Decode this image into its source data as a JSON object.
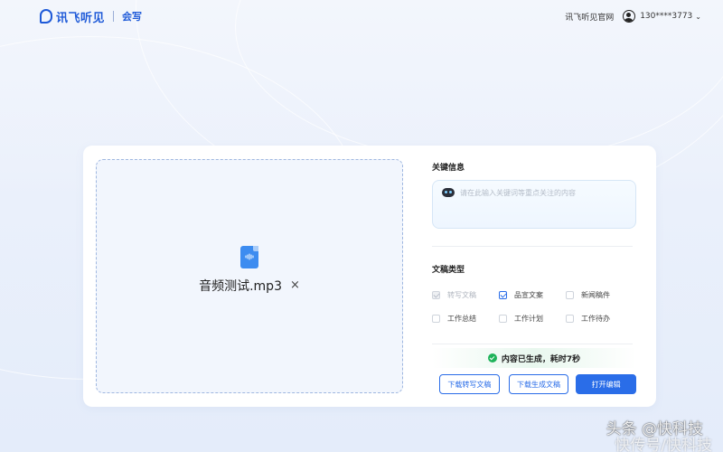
{
  "header": {
    "logo_text": "讯飞听见",
    "logo_sub": "会写",
    "official_site": "讯飞听见官网",
    "user_phone": "130****3773"
  },
  "upload": {
    "file_name": "音频测试.mp3",
    "close_glyph": "×",
    "file_icon": "audio-file-icon"
  },
  "keywords": {
    "title": "关键信息",
    "placeholder": "请在此输入关键词等重点关注的内容",
    "icon": "robot-icon"
  },
  "doc_types": {
    "title": "文稿类型",
    "options": [
      {
        "label": "转写文稿",
        "state": "checked-disabled"
      },
      {
        "label": "品宣文案",
        "state": "checked"
      },
      {
        "label": "新闻稿件",
        "state": "unchecked"
      },
      {
        "label": "工作总结",
        "state": "unchecked"
      },
      {
        "label": "工作计划",
        "state": "unchecked"
      },
      {
        "label": "工作待办",
        "state": "unchecked"
      }
    ]
  },
  "status": {
    "text": "内容已生成，耗时7秒",
    "icon": "check-circle-icon",
    "color": "#1fb35a"
  },
  "actions": {
    "download_transcript": "下载转写文稿",
    "download_generated": "下载生成文稿",
    "open_editor": "打开编辑"
  },
  "colors": {
    "accent": "#2a6de8",
    "brand": "#1e5ad8"
  },
  "watermark": {
    "line1": "头条 @快科技",
    "line2": "快传号/快科技"
  }
}
